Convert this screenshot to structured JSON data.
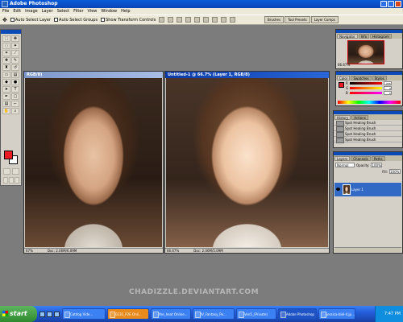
{
  "app": {
    "title": "Adobe Photoshop"
  },
  "menu": [
    "File",
    "Edit",
    "Image",
    "Layer",
    "Select",
    "Filter",
    "View",
    "Window",
    "Help"
  ],
  "options": {
    "auto_select_layer": "Auto Select Layer",
    "auto_select_groups": "Auto Select Groups",
    "show_transform": "Show Transform Controls"
  },
  "palette_well": [
    "Brushes",
    "Tool Presets",
    "Layer Comps"
  ],
  "doc1": {
    "title": "RGB/8)",
    "zoom": "67%",
    "doc": "Doc: 2.06M/6.09M"
  },
  "doc2": {
    "title": "Untitled-1 @ 66.7% (Layer 1, RGB/8)",
    "zoom": "66.67%",
    "doc": "Doc: 2.06M/5.09M"
  },
  "navigator": {
    "tabs": [
      "Navigator",
      "Info",
      "Histogram"
    ],
    "zoom": "66.67%"
  },
  "color": {
    "tabs": [
      "Color",
      "Swatches",
      "Styles"
    ],
    "values": [
      "255",
      "0",
      "0"
    ],
    "fg": "#ed1c24"
  },
  "history": {
    "tabs": [
      "History",
      "Actions"
    ],
    "items": [
      "Spot Healing Brush",
      "Spot Healing Brush",
      "Spot Healing Brush",
      "Spot Healing Brush"
    ]
  },
  "layers": {
    "tabs": [
      "Layers",
      "Channels",
      "Paths"
    ],
    "blend": "Normal",
    "opacity_label": "Opacity:",
    "opacity": "100%",
    "fill_label": "Fill:",
    "fill": "100%",
    "layer_name": "Layer 1"
  },
  "watermark": "CHADIZZLE.DEVIANTART.COM",
  "taskbar": {
    "start": "start",
    "buttons": [
      {
        "label": "Catdog Vide...",
        "style": "normal"
      },
      {
        "label": "0231_P2E Onli...",
        "style": "orange"
      },
      {
        "label": "the_heat Online...",
        "style": "normal"
      },
      {
        "label": "IV_Fantasy_Po...",
        "style": "normal"
      },
      {
        "label": "Ven5_(Private)",
        "style": "normal"
      },
      {
        "label": "Adobe Photoshop",
        "style": "active"
      },
      {
        "label": "jessica-biel-4.jp...",
        "style": "normal"
      }
    ],
    "clock": "7:47 PM"
  }
}
